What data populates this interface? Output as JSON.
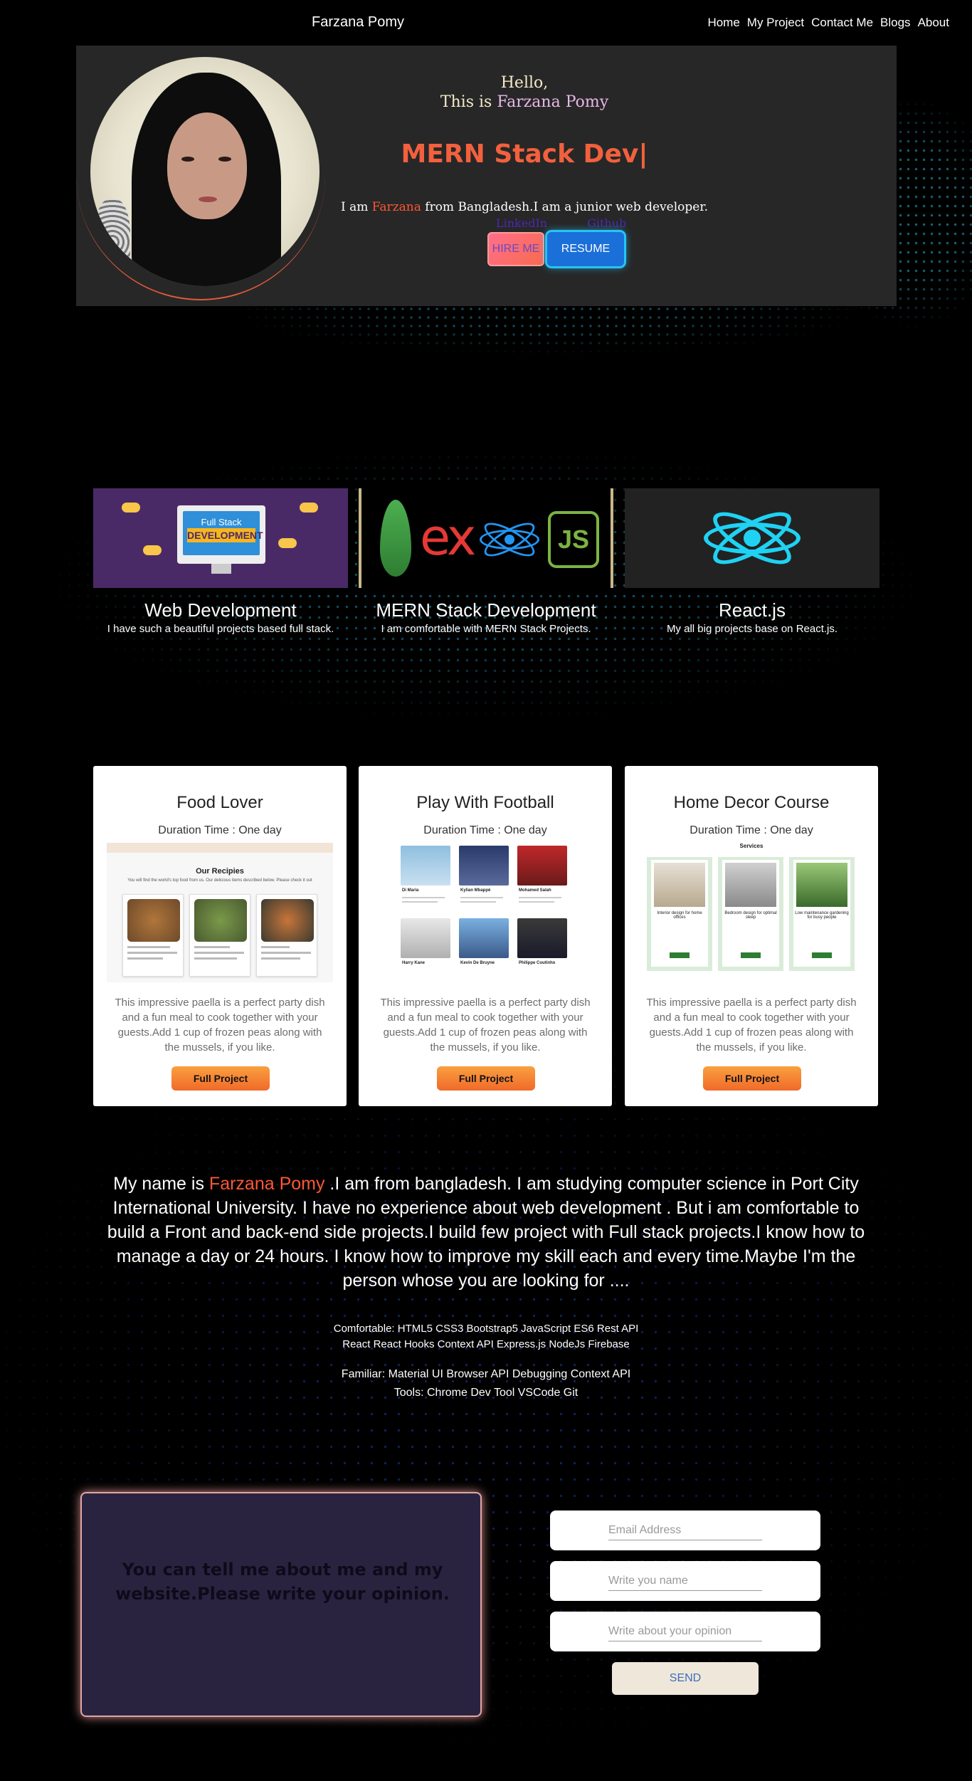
{
  "nav": {
    "brand": "Farzana Pomy",
    "links": [
      "Home",
      "My Project",
      "Contact Me",
      "Blogs",
      "About"
    ]
  },
  "hero": {
    "hello_line1": "Hello,",
    "hello_line2_prefix": "This is ",
    "hello_line2_name": "Farzana Pomy",
    "role": "MERN Stack Dev|",
    "intro_prefix": "I am ",
    "intro_name": "Farzana",
    "intro_suffix": " from Bangladesh.I am a junior web developer.",
    "social_links": [
      "LinkedIn",
      "Github"
    ],
    "hire_label": "HIRE ME",
    "resume_label": "RESUME",
    "avatar_alt": "profile photo"
  },
  "services": [
    {
      "title": "Web Development",
      "desc": "I have such a beautiful projects based full stack.",
      "banner_line1": "Full Stack",
      "banner_line2": "DEVELOPMENT"
    },
    {
      "title": "MERN Stack Development",
      "desc": "I am comfortable with MERN Stack Projects."
    },
    {
      "title": "React.js",
      "desc": "My all big projects base on React.js."
    }
  ],
  "projects": [
    {
      "title": "Food Lover",
      "duration": "Duration Time : One day",
      "shot_title": "Our Recipies",
      "shot_sub": "You will find the world's top food from us. Our delicious items described below. Please check it out",
      "desc": "This impressive paella is a perfect party dish and a fun meal to cook together with your guests.Add 1 cup of frozen peas along with the mussels, if you like.",
      "button": "Full Project"
    },
    {
      "title": "Play With Football",
      "duration": "Duration Time : One day",
      "players": [
        "Di Maria",
        "Kylian Mbappé",
        "Mohamed Salah",
        "Harry Kane",
        "Kevin De Bruyne",
        "Philippe Coutinho"
      ],
      "desc": "This impressive paella is a perfect party dish and a fun meal to cook together with your guests.Add 1 cup of frozen peas along with the mussels, if you like.",
      "button": "Full Project"
    },
    {
      "title": "Home Decor Course",
      "duration": "Duration Time : One day",
      "shot_title": "Services",
      "items": [
        "Interior design for home offices",
        "Bedroom design for optimal sleep",
        "Low maintenance gardening for busy people"
      ],
      "desc": "This impressive paella is a perfect party dish and a fun meal to cook together with your guests.Add 1 cup of frozen peas along with the mussels, if you like.",
      "button": "Full Project"
    }
  ],
  "about": {
    "prefix": "My name is ",
    "name": "Farzana Pomy",
    "body": " .I am from bangladesh. I am studying computer science in Port City International University. I have no experience about web development . But i am comfortable to build a Front and back-end side projects.I build few project with Full stack projects.I know how to manage a day or 24 hours. I know how to improve my skill each and every time.Maybe I'm the person whose you are looking for ....",
    "comfortable_1": "Comfortable: HTML5 CSS3 Bootstrap5 JavaScript ES6 Rest API",
    "comfortable_2": "React React Hooks Context API Express.js NodeJs Firebase",
    "familiar": "Familiar: Material UI Browser API Debugging Context API",
    "tools": "Tools: Chrome Dev Tool VSCode Git"
  },
  "contact": {
    "prompt": "You can tell me about me and my website.Please write your opinion.",
    "email_placeholder": "Email Address",
    "name_placeholder": "Write you name",
    "opinion_placeholder": "Write about your opinion",
    "send_label": "SEND"
  },
  "colors": {
    "accent": "#ff5733",
    "role": "#f2603d",
    "resume": "#1b6fd8",
    "card_button": "#f6883a"
  }
}
